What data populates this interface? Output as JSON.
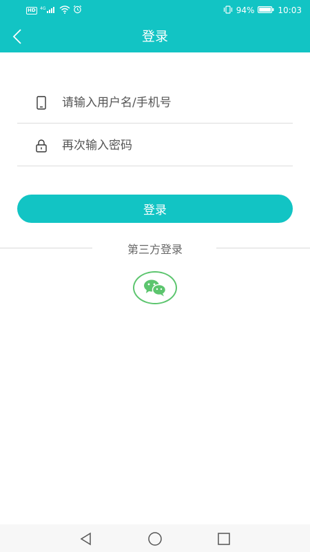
{
  "status_bar": {
    "left_badge": "HD",
    "network": "4G",
    "battery": "94%",
    "time": "10:03"
  },
  "header": {
    "title": "登录"
  },
  "form": {
    "username_placeholder": "请输入用户名/手机号",
    "password_placeholder": "再次输入密码",
    "login_label": "登录"
  },
  "third_party": {
    "label": "第三方登录",
    "providers": [
      "wechat"
    ]
  },
  "colors": {
    "accent": "#12c4c4",
    "wechat": "#5cc56e"
  },
  "icons": {
    "back": "chevron-left-icon",
    "phone": "phone-icon",
    "lock": "lock-icon",
    "wechat": "wechat-icon"
  }
}
